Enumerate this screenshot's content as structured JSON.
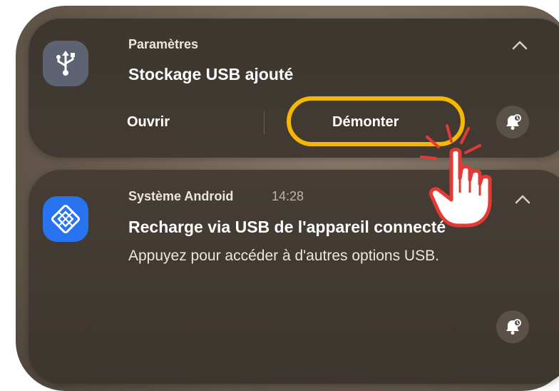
{
  "notifications": [
    {
      "app_name": "Paramètres",
      "title": "Stockage USB ajouté",
      "actions": {
        "open_label": "Ouvrir",
        "unmount_label": "Démonter"
      },
      "icon": "usb-icon",
      "icon_bg": "#5e6374"
    },
    {
      "app_name": "Système Android",
      "time": "14:28",
      "title": "Recharge via USB de l'appareil connecté",
      "body": "Appuyez pour accéder à d'autres options USB.",
      "icon": "android-system-icon",
      "icon_bg": "#2873f0"
    }
  ],
  "annotations": {
    "highlight_color": "#f5b800",
    "pointer_color": "#e53935",
    "pointer_icon": "tap-hand-icon"
  }
}
